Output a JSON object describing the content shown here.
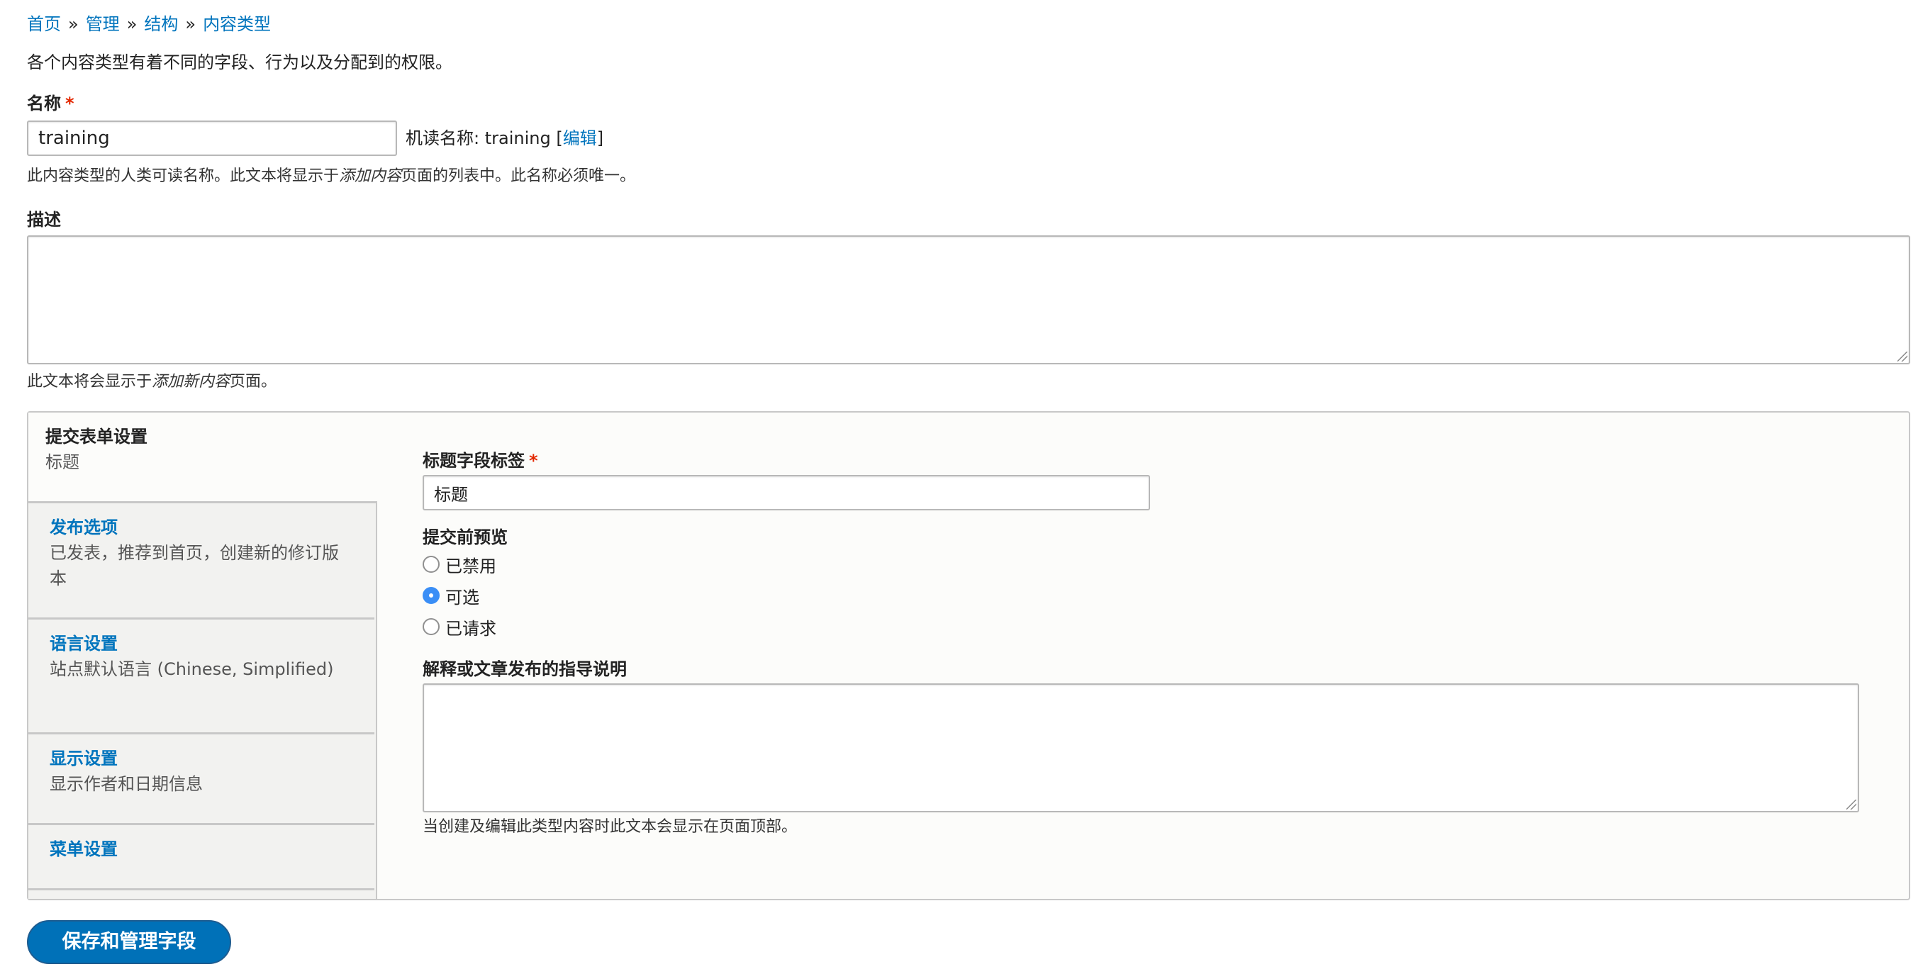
{
  "breadcrumb": {
    "items": [
      "首页",
      "管理",
      "结构",
      "内容类型"
    ],
    "separator": "»"
  },
  "intro": "各个内容类型有着不同的字段、行为以及分配到的权限。",
  "name": {
    "label": "名称",
    "required_mark": "*",
    "value": "training",
    "machine_prefix": "机读名称: training [",
    "machine_edit": "编辑",
    "machine_suffix": "]",
    "help_before": "此内容类型的人类可读名称。此文本将显示于",
    "help_em": "添加内容",
    "help_after": "页面的列表中。此名称必须唯一。"
  },
  "description": {
    "label": "描述",
    "value": "",
    "help_before": "此文本将会显示于",
    "help_em": "添加新内容",
    "help_after": "页面。"
  },
  "vertical_tabs": [
    {
      "title": "提交表单设置",
      "summary": "标题",
      "selected": true
    },
    {
      "title": "发布选项",
      "summary": "已发表，推荐到首页，创建新的修订版本",
      "selected": false
    },
    {
      "title": "语言设置",
      "summary": "站点默认语言 (Chinese, Simplified)",
      "selected": false
    },
    {
      "title": "显示设置",
      "summary": "显示作者和日期信息",
      "selected": false
    },
    {
      "title": "菜单设置",
      "summary": "",
      "selected": false
    }
  ],
  "submission": {
    "title_label": "标题字段标签",
    "required_mark": "*",
    "title_value": "标题",
    "preview_label": "提交前预览",
    "preview_options": [
      "已禁用",
      "可选",
      "已请求"
    ],
    "preview_selected": "可选",
    "guidelines_label": "解释或文章发布的指导说明",
    "guidelines_value": "",
    "guidelines_help": "当创建及编辑此类型内容时此文本会显示在页面顶部。"
  },
  "actions": {
    "save_label": "保存和管理字段"
  },
  "colors": {
    "link": "#0074bd",
    "required": "#e32700",
    "primary_button": "#0071b8",
    "radio_selected": "#3a8ef6"
  }
}
